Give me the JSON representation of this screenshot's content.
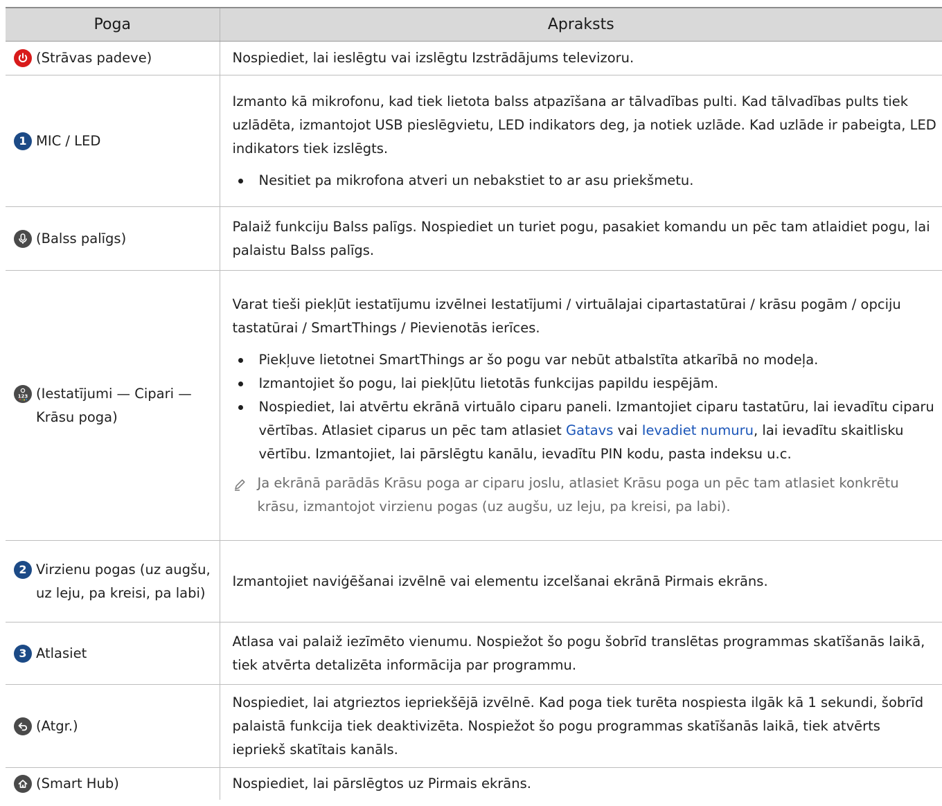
{
  "header": {
    "col1": "Poga",
    "col2": "Apraksts"
  },
  "rows": [
    {
      "button": "(Strāvas padeve)",
      "desc": "Nospiediet, lai ieslēgtu vai izslēgtu Izstrādājums televizoru."
    },
    {
      "badge": "1",
      "button": "MIC / LED",
      "desc": "Izmanto kā mikrofonu, kad tiek lietota balss atpazīšana ar tālvadības pulti. Kad tālvadības pults tiek uzlādēta, izmantojot USB pieslēgvietu, LED indikators deg, ja notiek uzlāde. Kad uzlāde ir pabeigta, LED indikators tiek izslēgts.",
      "bullets": [
        "Nesitiet pa mikrofona atveri un nebakstiet to ar asu priekšmetu."
      ]
    },
    {
      "button": "(Balss palīgs)",
      "desc": "Palaiž funkciju Balss palīgs. Nospiediet un turiet pogu, pasakiet komandu un pēc tam atlaidiet pogu, lai palaistu Balss palīgs."
    },
    {
      "button": "(Iestatījumi — Cipari — Krāsu poga)",
      "desc": "Varat tieši piekļūt iestatījumu izvēlnei Iestatījumi / virtuālajai cipartastatūrai / krāsu pogām / opciju tastatūrai / SmartThings / Pievienotās ierīces.",
      "bullets": [
        "Piekļuve lietotnei SmartThings ar šo pogu var nebūt atbalstīta atkarībā no modeļa.",
        "Izmantojiet šo pogu, lai piekļūtu lietotās funkcijas papildu iespējām."
      ],
      "bullet3_a": "Nospiediet, lai atvērtu ekrānā virtuālo ciparu paneli. Izmantojiet ciparu tastatūru, lai ievadītu ciparu vērtības. Atlasiet ciparus un pēc tam atlasiet ",
      "bullet3_link1": "Gatavs",
      "bullet3_b": " vai ",
      "bullet3_link2": "Ievadiet numuru",
      "bullet3_c": ", lai ievadītu skaitlisku vērtību. Izmantojiet, lai pārslēgtu kanālu, ievadītu PIN kodu, pasta indeksu u.c.",
      "note": "Ja ekrānā parādās Krāsu poga ar ciparu joslu, atlasiet Krāsu poga un pēc tam atlasiet konkrētu krāsu, izmantojot virzienu pogas (uz augšu, uz leju, pa kreisi, pa labi)."
    },
    {
      "badge": "2",
      "button": "Virzienu pogas (uz augšu, uz leju, pa kreisi, pa labi)",
      "desc": "Izmantojiet naviģēšanai izvēlnē vai elementu izcelšanai ekrānā Pirmais ekrāns."
    },
    {
      "badge": "3",
      "button": "Atlasiet",
      "desc": "Atlasa vai palaiž iezīmēto vienumu. Nospiežot šo pogu šobrīd translētas programmas skatīšanās laikā, tiek atvērta detalizēta informācija par programmu."
    },
    {
      "button": "(Atgr.)",
      "desc": "Nospiediet, lai atgrieztos iepriekšējā izvēlnē. Kad poga tiek turēta nospiesta ilgāk kā 1 sekundi, šobrīd palaistā funkcija tiek deaktivizēta. Nospiežot šo pogu programmas skatīšanās laikā, tiek atvērts iepriekš skatītais kanāls."
    },
    {
      "button": "(Smart Hub)",
      "desc": "Nospiediet, lai pārslēgtos uz Pirmais ekrāns."
    }
  ],
  "colors": {
    "header_bg": "#d9d9d9",
    "badge": "#1c4a86",
    "power": "#d81b1b",
    "link": "#1a55b8",
    "note": "#6b6b6b"
  },
  "icons": [
    "power-icon",
    "mic-icon",
    "color-number-icon",
    "back-icon",
    "home-icon",
    "pencil-note-icon"
  ]
}
